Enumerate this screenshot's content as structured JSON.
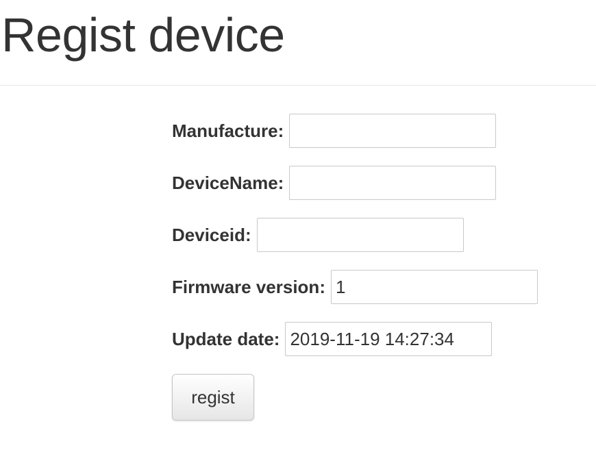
{
  "page": {
    "title": "Regist device"
  },
  "form": {
    "fields": [
      {
        "label": "Manufacture:",
        "value": ""
      },
      {
        "label": "DeviceName:",
        "value": ""
      },
      {
        "label": "Deviceid:",
        "value": ""
      },
      {
        "label": "Firmware version:",
        "value": "1"
      },
      {
        "label": "Update date:",
        "value": "2019-11-19 14:27:34"
      }
    ],
    "submit_label": "regist"
  },
  "colors": {
    "text": "#333333",
    "input_border": "#c8c8c8",
    "divider": "#e6e6e6"
  }
}
